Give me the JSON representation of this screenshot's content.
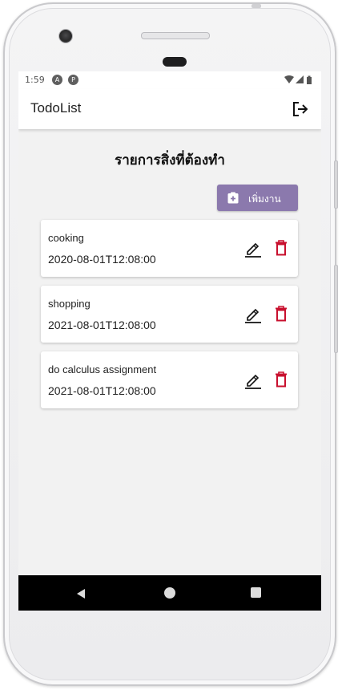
{
  "status_bar": {
    "time": "1:59",
    "icon_a": "A",
    "icon_b": "P",
    "right_icons": [
      "wifi-icon",
      "signal-icon",
      "battery-icon"
    ]
  },
  "app_bar": {
    "title": "TodoList",
    "logout_icon": "logout-icon"
  },
  "main": {
    "heading": "รายการสิ่งที่ต้องทำ",
    "add_button": {
      "label": "เพิ่มงาน",
      "icon": "add-task-icon"
    },
    "todos": [
      {
        "title": "cooking",
        "date": "2020-08-01T12:08:00"
      },
      {
        "title": "shopping",
        "date": "2021-08-01T12:08:00"
      },
      {
        "title": "do calculus assignment",
        "date": "2021-08-01T12:08:00"
      }
    ]
  },
  "colors": {
    "accent": "#8b79ad",
    "delete": "#c8102e",
    "screen_bg": "#f2f2f2",
    "nav_bar": "#000000"
  },
  "nav_bar": {
    "icons": [
      "back-icon",
      "home-icon",
      "recent-apps-icon"
    ]
  }
}
